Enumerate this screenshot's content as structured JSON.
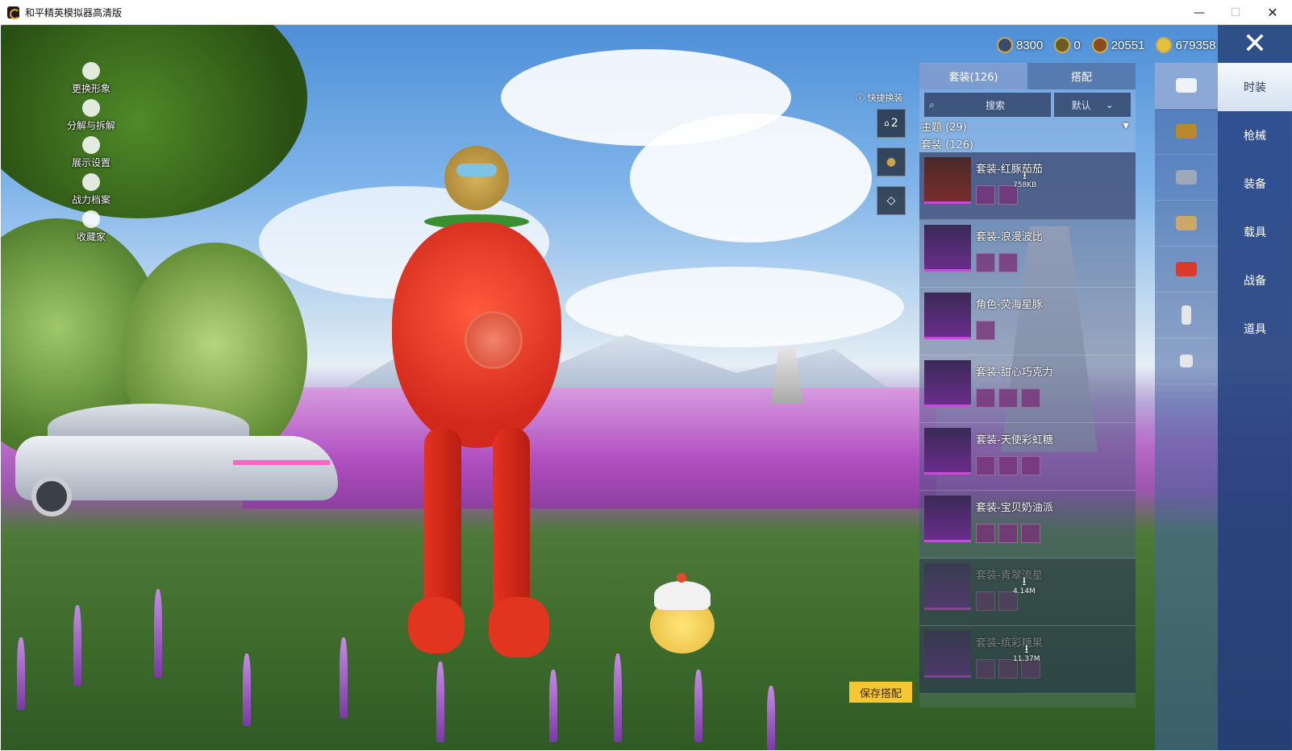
{
  "window": {
    "title": "和平精英模拟器高清版",
    "min": "—",
    "max": "☐",
    "close": "✕"
  },
  "left_menu": [
    {
      "label": "更换形象"
    },
    {
      "label": "分解与拆解"
    },
    {
      "label": "展示设置"
    },
    {
      "label": "战力档案"
    },
    {
      "label": "收藏家"
    }
  ],
  "currency": [
    {
      "icon": "coin-icon",
      "value": "8300"
    },
    {
      "icon": "gold-a-icon",
      "value": "0"
    },
    {
      "icon": "token-icon",
      "value": "20551"
    },
    {
      "icon": "diamond-coin-icon",
      "value": "679358"
    }
  ],
  "close_button": "✕",
  "categories": [
    {
      "label": "时装",
      "active": true
    },
    {
      "label": "枪械"
    },
    {
      "label": "装备"
    },
    {
      "label": "载具"
    },
    {
      "label": "战备"
    },
    {
      "label": "道具"
    }
  ],
  "panel": {
    "tab_outfit": "套装(126)",
    "tab_match": "搭配",
    "search_placeholder": "搜索",
    "sort_value": "默认",
    "theme_filter": "主题 (29)",
    "outfit_count": "套装 (126)"
  },
  "items": [
    {
      "name": "套装-红豚茄茄",
      "download": "758KB",
      "parts": 2
    },
    {
      "name": "套装-浪漫波比",
      "parts": 2
    },
    {
      "name": "角色-荧海星豚",
      "parts": 1
    },
    {
      "name": "套装-甜心巧克力",
      "parts": 3
    },
    {
      "name": "套装-天使彩虹糖",
      "parts": 3
    },
    {
      "name": "套装-宝贝奶油派",
      "parts": 3
    },
    {
      "name": "套装-青翠流星",
      "download": "4.14M",
      "parts": 2
    },
    {
      "name": "套装-缤彩糖果",
      "download": "11.37M",
      "parts": 3
    }
  ],
  "side": {
    "quick_swap": "快捷换装",
    "slot_number": "2"
  },
  "save_button": "保存搭配",
  "colors": {
    "panel_blue": "#2b4a8c",
    "save_yellow": "#f5c731",
    "accent_purple": "#c74bd9"
  }
}
